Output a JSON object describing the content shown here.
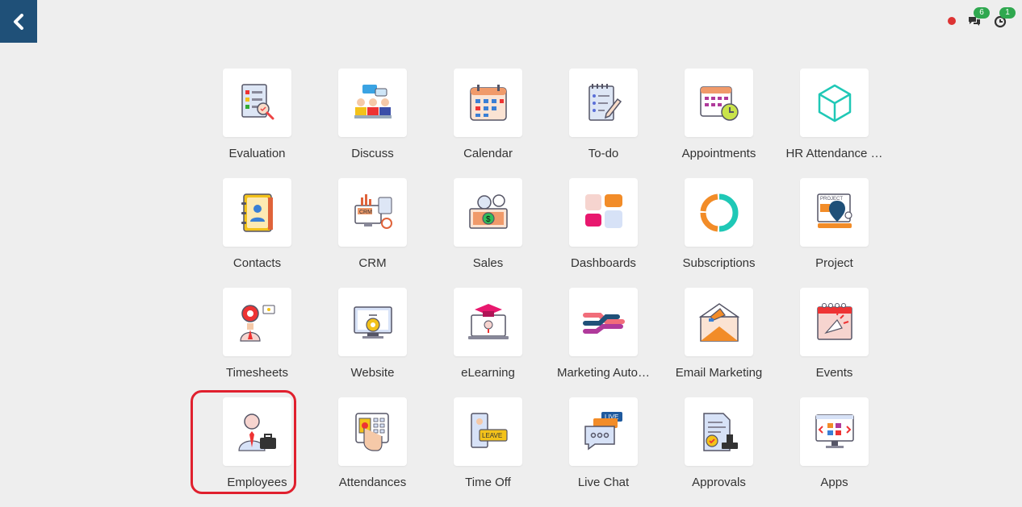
{
  "nav": {
    "back_icon": "chevron-left-icon"
  },
  "systray": {
    "status_color": "#d33333",
    "messages_badge": "6",
    "activities_badge": "1"
  },
  "apps": [
    {
      "label": "Evaluation",
      "icon": "evaluation-icon"
    },
    {
      "label": "Discuss",
      "icon": "discuss-icon"
    },
    {
      "label": "Calendar",
      "icon": "calendar-icon"
    },
    {
      "label": "To-do",
      "icon": "todo-icon"
    },
    {
      "label": "Appointments",
      "icon": "appointments-icon"
    },
    {
      "label": "HR Attendance …",
      "icon": "hr-attendance-icon"
    },
    {
      "label": "Contacts",
      "icon": "contacts-icon"
    },
    {
      "label": "CRM",
      "icon": "crm-icon"
    },
    {
      "label": "Sales",
      "icon": "sales-icon"
    },
    {
      "label": "Dashboards",
      "icon": "dashboards-icon"
    },
    {
      "label": "Subscriptions",
      "icon": "subscriptions-icon"
    },
    {
      "label": "Project",
      "icon": "project-icon"
    },
    {
      "label": "Timesheets",
      "icon": "timesheets-icon"
    },
    {
      "label": "Website",
      "icon": "website-icon"
    },
    {
      "label": "eLearning",
      "icon": "elearning-icon"
    },
    {
      "label": "Marketing Auto…",
      "icon": "marketing-automation-icon"
    },
    {
      "label": "Email Marketing",
      "icon": "email-marketing-icon"
    },
    {
      "label": "Events",
      "icon": "events-icon"
    },
    {
      "label": "Employees",
      "icon": "employees-icon"
    },
    {
      "label": "Attendances",
      "icon": "attendances-icon"
    },
    {
      "label": "Time Off",
      "icon": "time-off-icon"
    },
    {
      "label": "Live Chat",
      "icon": "live-chat-icon"
    },
    {
      "label": "Approvals",
      "icon": "approvals-icon"
    },
    {
      "label": "Apps",
      "icon": "apps-icon"
    }
  ],
  "icon_text": {
    "crm": "CRM",
    "project": "PROJECT",
    "leave": "LEAVE",
    "live": "LIVE",
    "sales_currency": "$"
  },
  "highlighted_app": "Employees",
  "colors": {
    "back_button": "#1f5078",
    "highlight": "#e0202e",
    "badge": "#2fa84f"
  }
}
